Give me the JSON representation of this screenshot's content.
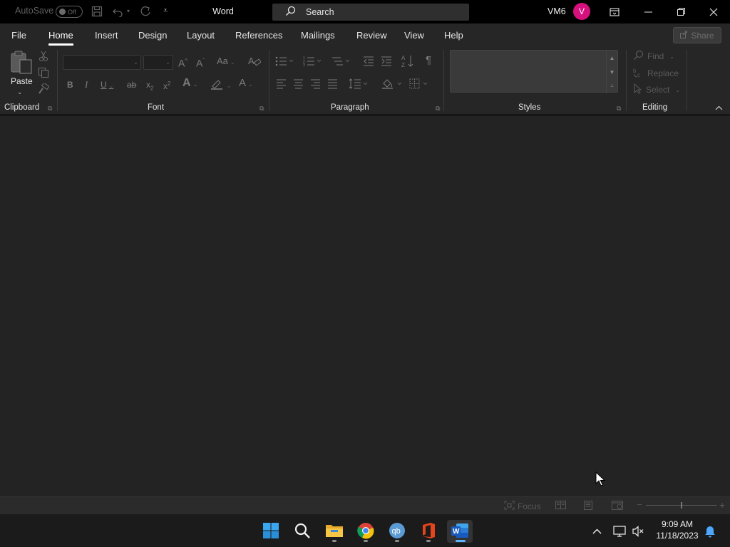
{
  "titlebar": {
    "autosave_label": "AutoSave",
    "autosave_state": "Off",
    "app_title": "Word",
    "search_label": "Search",
    "user_name": "VM6",
    "avatar_initial": "V"
  },
  "menu": {
    "tabs": [
      "File",
      "Home",
      "Insert",
      "Design",
      "Layout",
      "References",
      "Mailings",
      "Review",
      "View",
      "Help"
    ],
    "active_tab": "Home",
    "share_label": "Share"
  },
  "ribbon": {
    "clipboard": {
      "label": "Clipboard",
      "paste_label": "Paste"
    },
    "font": {
      "label": "Font"
    },
    "paragraph": {
      "label": "Paragraph"
    },
    "styles": {
      "label": "Styles"
    },
    "editing": {
      "label": "Editing",
      "find_label": "Find",
      "replace_label": "Replace",
      "select_label": "Select"
    }
  },
  "statusbar": {
    "focus_label": "Focus",
    "zoom_minus": "−",
    "zoom_plus": "+"
  },
  "taskbar": {
    "apps": [
      {
        "name": "Start",
        "icon": "windows-logo-icon"
      },
      {
        "name": "Search",
        "icon": "search-icon"
      },
      {
        "name": "File Explorer",
        "icon": "folder-icon"
      },
      {
        "name": "Google Chrome",
        "icon": "chrome-icon"
      },
      {
        "name": "qBittorrent",
        "icon": "qbittorrent-icon"
      },
      {
        "name": "Office",
        "icon": "office-icon"
      },
      {
        "name": "Word",
        "icon": "word-icon"
      }
    ],
    "time": "9:09 AM",
    "date": "11/18/2023"
  },
  "colors": {
    "accent_avatar": "#d6117e",
    "word_blue": "#185abd",
    "taskbar_active": "#5eb4ff"
  }
}
